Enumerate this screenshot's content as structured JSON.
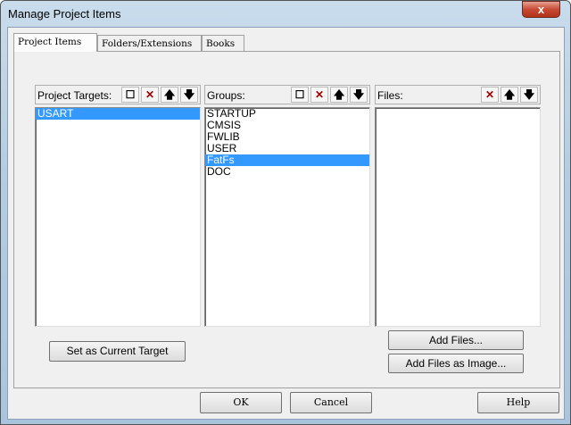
{
  "window": {
    "title": "Manage Project Items",
    "close": "x"
  },
  "tabs": [
    "Project Items",
    "Folders/Extensions",
    "Books"
  ],
  "targets": {
    "label": "Project Targets:",
    "items": [
      "USART"
    ],
    "selected": 0
  },
  "groups": {
    "label": "Groups:",
    "items": [
      "STARTUP",
      "CMSIS",
      "FWLIB",
      "USER",
      "FatFs",
      "DOC"
    ],
    "selected": 4
  },
  "files": {
    "label": "Files:",
    "items": []
  },
  "icons": {
    "new": "☐",
    "delete": "✕",
    "up": "🡅",
    "down": "🡇"
  },
  "buttons": {
    "set_current": "Set as Current Target",
    "add_files": "Add Files...",
    "add_image": "Add Files as Image...",
    "ok": "OK",
    "cancel": "Cancel",
    "help": "Help"
  }
}
